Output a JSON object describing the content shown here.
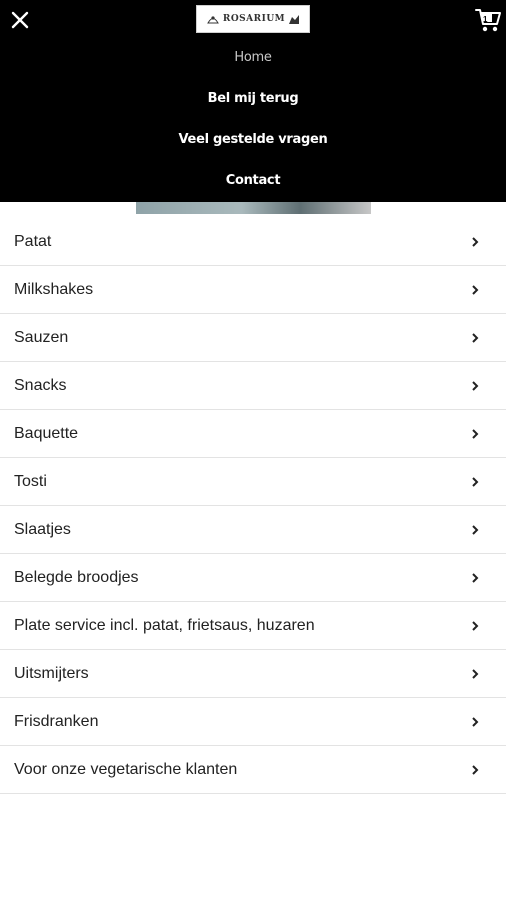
{
  "header": {
    "logo_text": "ROSARIUM",
    "cart_count": "1"
  },
  "nav": {
    "items": [
      {
        "label": "Home",
        "active": true
      },
      {
        "label": "Bel mij terug",
        "active": false
      },
      {
        "label": "Veel gestelde vragen",
        "active": false
      },
      {
        "label": "Contact",
        "active": false
      }
    ]
  },
  "categories": [
    {
      "label": "Patat"
    },
    {
      "label": "Milkshakes"
    },
    {
      "label": "Sauzen"
    },
    {
      "label": "Snacks"
    },
    {
      "label": "Baquette"
    },
    {
      "label": "Tosti"
    },
    {
      "label": "Slaatjes"
    },
    {
      "label": "Belegde broodjes"
    },
    {
      "label": "Plate service incl. patat, frietsaus, huzaren"
    },
    {
      "label": "Uitsmijters"
    },
    {
      "label": "Frisdranken"
    },
    {
      "label": "Voor onze vegetarische klanten"
    }
  ],
  "icons": {
    "close": "close-icon",
    "cart": "cart-icon",
    "chevron": "chevron-right-icon"
  },
  "colors": {
    "header_bg": "#000000",
    "nav_active": "#c8c8c8",
    "nav_text": "#ffffff",
    "row_divider": "#e3e3e3",
    "row_text": "#222222"
  }
}
